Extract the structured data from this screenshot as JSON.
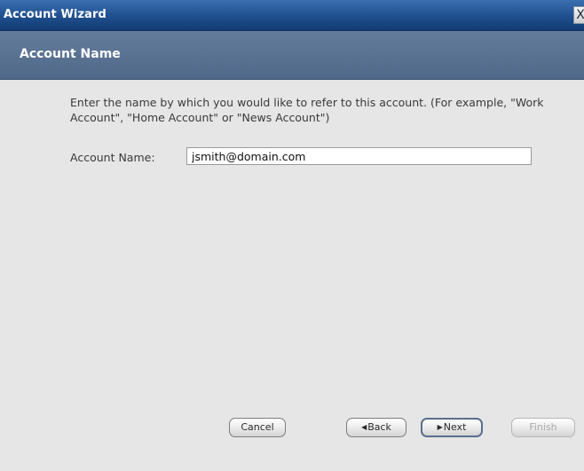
{
  "window": {
    "title": "Account Wizard",
    "close_glyph": "X"
  },
  "header": {
    "page_title": "Account Name"
  },
  "main": {
    "instructions": "Enter the name by which you would like to refer to this account. (For example, \"Work Account\", \"Home Account\" or \"News Account\")",
    "account_name_label": "Account Name:",
    "account_name_value": "jsmith@domain.com"
  },
  "buttons": {
    "cancel": "Cancel",
    "back": "Back",
    "back_icon": "◀",
    "next": "Next",
    "next_icon": "▶",
    "finish": "Finish"
  },
  "colors": {
    "titlebar": "#1f4f8e",
    "header_band": "#5a7394",
    "content_bg": "#e6e6e6"
  }
}
